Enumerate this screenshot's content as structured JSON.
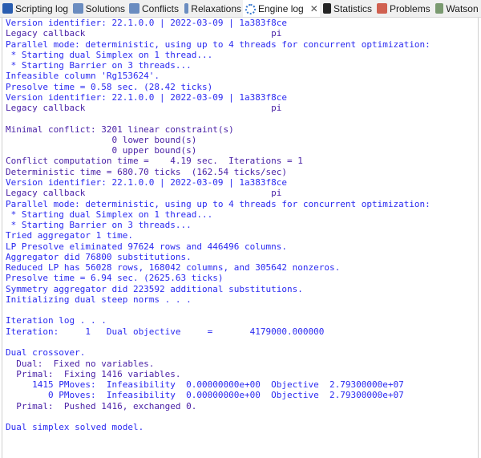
{
  "tabs": [
    {
      "label": "Scripting log",
      "icon": "monitor-icon",
      "color": "#2a5db0"
    },
    {
      "label": "Solutions",
      "icon": "solutions-icon",
      "color": "#6a8cc0"
    },
    {
      "label": "Conflicts",
      "icon": "conflicts-icon",
      "color": "#6a8cc0"
    },
    {
      "label": "Relaxations",
      "icon": "relaxations-icon",
      "color": "#6a8cc0"
    },
    {
      "label": "Engine log",
      "icon": "engine-spinner-icon",
      "color": "#3a7ad0",
      "active": true
    },
    {
      "label": "Statistics",
      "icon": "statistics-icon",
      "color": "#222222"
    },
    {
      "label": "Problems",
      "icon": "problems-icon",
      "color": "#d06050"
    },
    {
      "label": "Watson M",
      "icon": "watson-icon",
      "color": "#7a9a70"
    }
  ],
  "close_symbol": "✕",
  "log_lines": [
    {
      "t": "Version identifier: 22.1.0.0 | 2022-03-09 | 1a383f8ce",
      "c": "blue"
    },
    {
      "t": "Legacy callback                                   pi",
      "c": "purple"
    },
    {
      "t": "Parallel mode: deterministic, using up to 4 threads for concurrent optimization:",
      "c": "blue"
    },
    {
      "t": " * Starting dual Simplex on 1 thread...",
      "c": "blue"
    },
    {
      "t": " * Starting Barrier on 3 threads...",
      "c": "blue"
    },
    {
      "t": "Infeasible column 'Rg153624'.",
      "c": "blue"
    },
    {
      "t": "Presolve time = 0.58 sec. (28.42 ticks)",
      "c": "blue"
    },
    {
      "t": "Version identifier: 22.1.0.0 | 2022-03-09 | 1a383f8ce",
      "c": "blue"
    },
    {
      "t": "Legacy callback                                   pi",
      "c": "purple"
    },
    {
      "t": "",
      "c": "blue"
    },
    {
      "t": "Minimal conflict: 3201 linear constraint(s)",
      "c": "purple"
    },
    {
      "t": "                    0 lower bound(s)",
      "c": "purple"
    },
    {
      "t": "                    0 upper bound(s)",
      "c": "purple"
    },
    {
      "t": "Conflict computation time =    4.19 sec.  Iterations = 1",
      "c": "purple"
    },
    {
      "t": "Deterministic time = 680.70 ticks  (162.54 ticks/sec)",
      "c": "purple"
    },
    {
      "t": "Version identifier: 22.1.0.0 | 2022-03-09 | 1a383f8ce",
      "c": "blue"
    },
    {
      "t": "Legacy callback                                   pi",
      "c": "purple"
    },
    {
      "t": "Parallel mode: deterministic, using up to 4 threads for concurrent optimization:",
      "c": "blue"
    },
    {
      "t": " * Starting dual Simplex on 1 thread...",
      "c": "blue"
    },
    {
      "t": " * Starting Barrier on 3 threads...",
      "c": "blue"
    },
    {
      "t": "Tried aggregator 1 time.",
      "c": "blue"
    },
    {
      "t": "LP Presolve eliminated 97624 rows and 446496 columns.",
      "c": "blue"
    },
    {
      "t": "Aggregator did 76800 substitutions.",
      "c": "blue"
    },
    {
      "t": "Reduced LP has 56028 rows, 168042 columns, and 305642 nonzeros.",
      "c": "blue"
    },
    {
      "t": "Presolve time = 6.94 sec. (2625.63 ticks)",
      "c": "blue"
    },
    {
      "t": "Symmetry aggregator did 223592 additional substitutions.",
      "c": "blue"
    },
    {
      "t": "Initializing dual steep norms . . .",
      "c": "blue"
    },
    {
      "t": "",
      "c": "blue"
    },
    {
      "t": "Iteration log . . .",
      "c": "blue"
    },
    {
      "t": "Iteration:     1   Dual objective     =       4179000.000000",
      "c": "blue"
    },
    {
      "t": "",
      "c": "blue"
    },
    {
      "t": "Dual crossover.",
      "c": "blue"
    },
    {
      "t": "  Dual:  Fixed no variables.",
      "c": "purple"
    },
    {
      "t": "  Primal:  Fixing 1416 variables.",
      "c": "purple"
    },
    {
      "t": "     1415 PMoves:  Infeasibility  0.00000000e+00  Objective  2.79300000e+07",
      "c": "blue"
    },
    {
      "t": "        0 PMoves:  Infeasibility  0.00000000e+00  Objective  2.79300000e+07",
      "c": "blue"
    },
    {
      "t": "  Primal:  Pushed 1416, exchanged 0.",
      "c": "purple"
    },
    {
      "t": "",
      "c": "blue"
    },
    {
      "t": "Dual simplex solved model.",
      "c": "blue"
    }
  ]
}
